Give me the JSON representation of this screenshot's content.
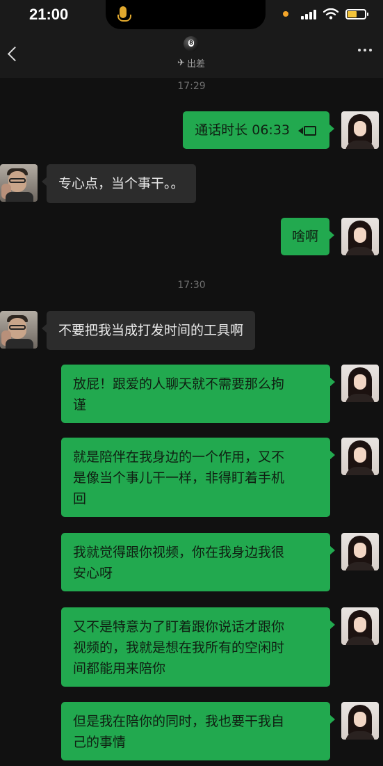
{
  "status_bar": {
    "time": "21:00"
  },
  "nav": {
    "contact_icon": "8-ball-icon",
    "status_text": "出差",
    "status_icon": "airplane-icon"
  },
  "chat": {
    "timestamps": [
      "17:29",
      "17:30"
    ],
    "messages": [
      {
        "sender": "me",
        "text": "通话时长 06:33",
        "icon": "video-call-icon"
      },
      {
        "sender": "other",
        "text": "专心点，当个事干。。"
      },
      {
        "sender": "me",
        "text": "啥啊"
      },
      {
        "sender": "other",
        "text": "不要把我当成打发时间的工具啊"
      },
      {
        "sender": "me",
        "lines": [
          "放屁！跟爱的人聊天就不需要那么拘",
          "谨"
        ]
      },
      {
        "sender": "me",
        "lines": [
          "就是陪伴在我身边的一个作用，又不",
          "是像当个事儿干一样，非得盯着手机",
          "回"
        ]
      },
      {
        "sender": "me",
        "lines": [
          "我就觉得跟你视频，你在我身边我很",
          "安心呀"
        ]
      },
      {
        "sender": "me",
        "lines": [
          "又不是特意为了盯着跟你说话才跟你",
          "视频的，我就是想在我所有的空闲时",
          "间都能用来陪你"
        ]
      },
      {
        "sender": "me",
        "lines": [
          "但是我在陪你的同时，我也要干我自",
          "己的事情"
        ]
      }
    ]
  },
  "colors": {
    "bubble_me": "#22a94f",
    "bubble_other": "#2c2c2c",
    "background": "#111111"
  }
}
